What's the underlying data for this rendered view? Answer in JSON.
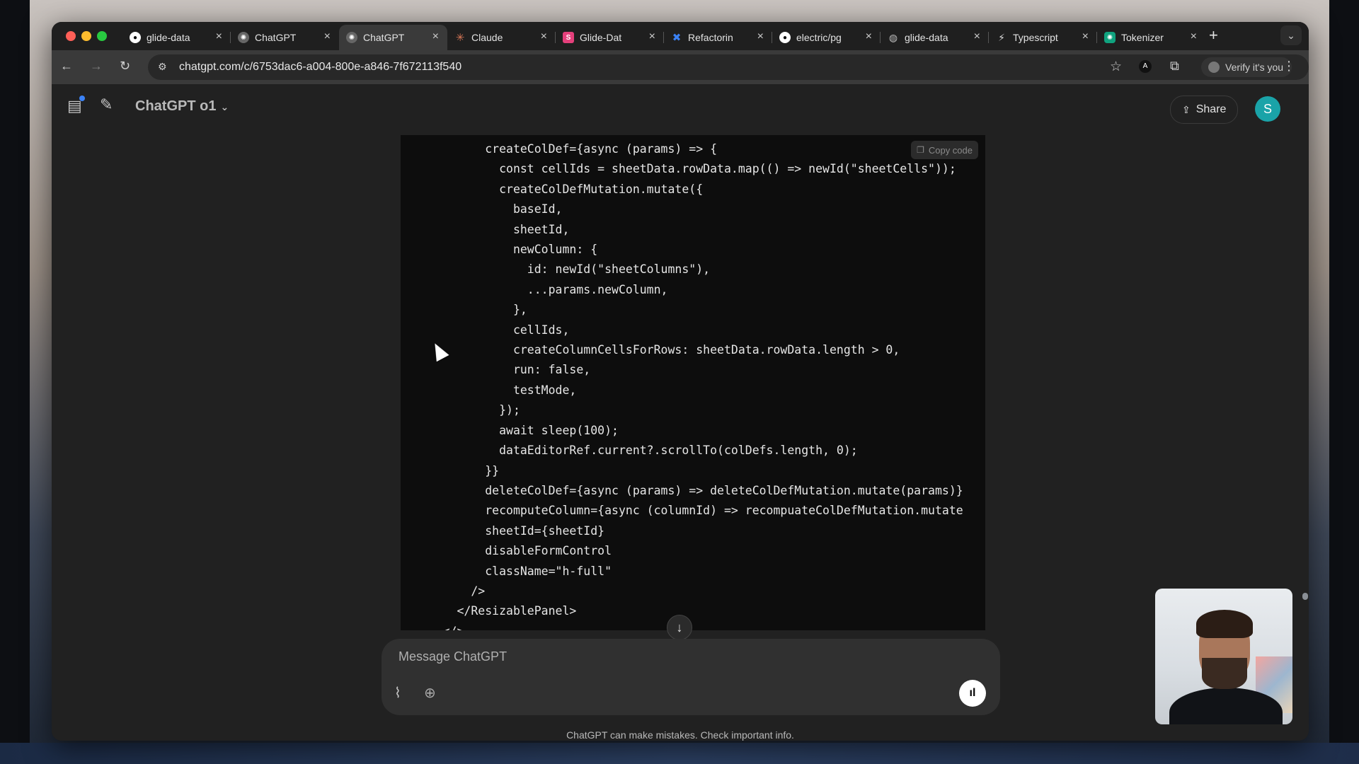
{
  "browser": {
    "tabs": [
      {
        "title": "glide-data",
        "icon": "github-icon",
        "active": false
      },
      {
        "title": "ChatGPT",
        "icon": "chatgpt-icon",
        "active": false
      },
      {
        "title": "ChatGPT",
        "icon": "chatgpt-icon",
        "active": true
      },
      {
        "title": "Claude",
        "icon": "claude-icon",
        "active": false
      },
      {
        "title": "Glide-Dat",
        "icon": "s-icon",
        "active": false
      },
      {
        "title": "Refactorin",
        "icon": "x-icon",
        "active": false
      },
      {
        "title": "electric/pg",
        "icon": "github-icon",
        "active": false
      },
      {
        "title": "glide-data",
        "icon": "globe-icon",
        "active": false
      },
      {
        "title": "Typescript",
        "icon": "bolt-icon",
        "active": false
      },
      {
        "title": "Tokenizer",
        "icon": "tokenizer-icon",
        "active": false
      }
    ],
    "url": "chatgpt.com/c/6753dac6-a004-800e-a846-7f672113f540",
    "profile_label": "Verify it's you",
    "extension_badge": "A",
    "accent": "#3a3a3a"
  },
  "chat": {
    "model_label": "ChatGPT o1",
    "share_label": "Share",
    "avatar_letter": "S",
    "copy_label": "Copy code",
    "code_lines": [
      "            createColDef={async (params) => {",
      "              const cellIds = sheetData.rowData.map(() => newId(\"sheetCells\"));",
      "              createColDefMutation.mutate({",
      "                baseId,",
      "                sheetId,",
      "                newColumn: {",
      "                  id: newId(\"sheetColumns\"),",
      "                  ...params.newColumn,",
      "                },",
      "                cellIds,",
      "                createColumnCellsForRows: sheetData.rowData.length > 0,",
      "                run: false,",
      "                testMode,",
      "              });",
      "              await sleep(100);",
      "              dataEditorRef.current?.scrollTo(colDefs.length, 0);",
      "            }}",
      "            deleteColDef={async (params) => deleteColDefMutation.mutate(params)}",
      "            recomputeColumn={async (columnId) => recompuateColDefMutation.mutate",
      "            sheetId={sheetId}",
      "            disableFormControl",
      "            className=\"h-full\"",
      "          />",
      "        </ResizablePanel>",
      "      </>"
    ],
    "composer_placeholder": "Message ChatGPT",
    "disclaimer": "ChatGPT can make mistakes. Check important info.",
    "avatar_color": "#1aa3a8"
  }
}
